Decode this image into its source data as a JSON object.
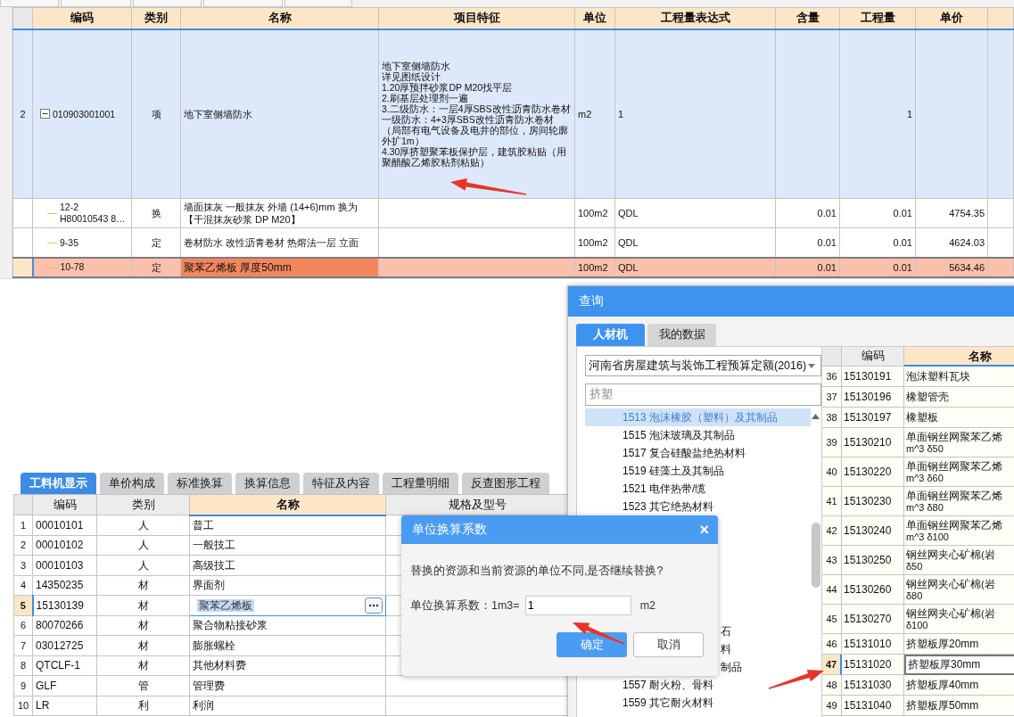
{
  "main_table": {
    "columns": [
      "编码",
      "类别",
      "名称",
      "项目特征",
      "单位",
      "工程量表达式",
      "含量",
      "工程量",
      "单价"
    ],
    "rows": [
      {
        "kind": "list_item",
        "number": "2",
        "code_lines": [
          "010903001001"
        ],
        "expanded": true,
        "category": "项",
        "name": "地下室侧墙防水",
        "features": [
          "地下室侧墙防水",
          "详见图纸设计",
          "1.20厚预拌砂浆DP M20找平层",
          "2.刷基层处理剂一遍",
          "3.二级防水：一层4厚SBS改性沥青防水卷材",
          "一级防水：4+3厚SBS改性沥青防水卷材（局部有电气设备及电井的部位，房间轮廓外扩1m）",
          "4.30厚挤塑聚苯板保护层，建筑胶粘贴（用聚醋酸乙烯胶粘剂粘贴）"
        ],
        "unit": "m2",
        "expression": "1",
        "quantity": "1",
        "selected": false
      },
      {
        "kind": "quota",
        "code_lines": [
          "12-2",
          "H80010543 8…"
        ],
        "category": "换",
        "name": "墙面抹灰 一般抹灰 外墙 (14+6)mm  换为【干混抹灰砂浆 DP M20】",
        "unit": "100m2",
        "expression": "QDL",
        "content": "0.01",
        "quantity": "0.01",
        "price": "4754.35",
        "selected": false
      },
      {
        "kind": "quota",
        "code_lines": [
          "9-35"
        ],
        "category": "定",
        "name": "卷材防水 改性沥青卷材 热熔法一层 立面",
        "unit": "100m2",
        "expression": "QDL",
        "content": "0.01",
        "quantity": "0.01",
        "price": "4624.03",
        "selected": false
      },
      {
        "kind": "quota",
        "code_lines": [
          "10-78"
        ],
        "category": "定",
        "name": "聚苯乙烯板 厚度50mm",
        "unit": "100m2",
        "expression": "QDL",
        "content": "0.01",
        "quantity": "0.01",
        "price": "5634.46",
        "selected": true
      }
    ]
  },
  "detail_tabs": [
    {
      "label": "工料机显示",
      "selected": true
    },
    {
      "label": "单价构成",
      "selected": false
    },
    {
      "label": "标准换算",
      "selected": false
    },
    {
      "label": "换算信息",
      "selected": false
    },
    {
      "label": "特征及内容",
      "selected": false
    },
    {
      "label": "工程量明细",
      "selected": false
    },
    {
      "label": "反查图形工程",
      "selected": false
    }
  ],
  "resource_table": {
    "columns": [
      "编码",
      "类别",
      "名称",
      "规格及型号"
    ],
    "rows": [
      {
        "number": "1",
        "code": "00010101",
        "category": "人",
        "name": "普工",
        "selected": false
      },
      {
        "number": "2",
        "code": "00010102",
        "category": "人",
        "name": "一般技工",
        "selected": false
      },
      {
        "number": "3",
        "code": "00010103",
        "category": "人",
        "name": "高级技工",
        "selected": false
      },
      {
        "number": "4",
        "code": "14350235",
        "category": "材",
        "name": "界面剂",
        "selected": false
      },
      {
        "number": "5",
        "code": "15130139",
        "category": "材",
        "name": "聚苯乙烯板",
        "selected": true
      },
      {
        "number": "6",
        "code": "80070266",
        "category": "材",
        "name": "聚合物粘接砂浆",
        "selected": false
      },
      {
        "number": "7",
        "code": "03012725",
        "category": "材",
        "name": "膨胀螺栓",
        "selected": false
      },
      {
        "number": "8",
        "code": "QTCLF-1",
        "category": "材",
        "name": "其他材料费",
        "selected": false
      },
      {
        "number": "9",
        "code": "GLF",
        "category": "管",
        "name": "管理费",
        "selected": false
      },
      {
        "number": "10",
        "code": "LR",
        "category": "利",
        "name": "利润",
        "selected": false
      }
    ]
  },
  "query_dialog": {
    "title": "查询",
    "tabs": [
      {
        "label": "人材机",
        "selected": true
      },
      {
        "label": "我的数据",
        "selected": false
      }
    ],
    "library": "河南省房屋建筑与装饰工程预算定额(2016)",
    "search": {
      "value": "挤塑"
    },
    "tree": [
      {
        "label": "1513 泡沫橡胶（塑料）及其制品",
        "kind": "normal",
        "selected": true
      },
      {
        "label": "1515 泡沫玻璃及其制品",
        "kind": "normal",
        "selected": false
      },
      {
        "label": "1517 复合硅酸盐绝热材料",
        "kind": "normal",
        "selected": false
      },
      {
        "label": "1519 硅藻土及其制品",
        "kind": "normal",
        "selected": false
      },
      {
        "label": "1521 电伴热带/缆",
        "kind": "normal",
        "selected": false
      },
      {
        "label": "1523 其它绝热材料",
        "kind": "normal",
        "selected": false
      },
      {
        "label": "石",
        "kind": "partial",
        "selected": false
      },
      {
        "label": "料",
        "kind": "partial",
        "selected": false
      },
      {
        "label": "制品",
        "kind": "partial",
        "selected": false
      },
      {
        "label": "1557 耐火粉、骨料",
        "kind": "normal",
        "selected": false
      },
      {
        "label": "1559 其它耐火材料",
        "kind": "normal",
        "selected": false
      }
    ],
    "grid": {
      "columns": [
        "编码",
        "名称"
      ],
      "rows": [
        {
          "number": "36",
          "code": "15130191",
          "name": "泡沫塑料瓦块",
          "selected": false
        },
        {
          "number": "37",
          "code": "15130196",
          "name": "橡塑管壳",
          "selected": false
        },
        {
          "number": "38",
          "code": "15130197",
          "name": "橡塑板",
          "selected": false
        },
        {
          "number": "39",
          "code": "15130210",
          "name": "单面钢丝网聚苯乙烯",
          "detail": "m^3 δ50",
          "selected": false
        },
        {
          "number": "40",
          "code": "15130220",
          "name": "单面钢丝网聚苯乙烯",
          "detail": "m^3 δ60",
          "selected": false
        },
        {
          "number": "41",
          "code": "15130230",
          "name": "单面钢丝网聚苯乙烯",
          "detail": "m^3 δ80",
          "selected": false
        },
        {
          "number": "42",
          "code": "15130240",
          "name": "单面钢丝网聚苯乙烯",
          "detail": "m^3 δ100",
          "selected": false
        },
        {
          "number": "43",
          "code": "15130250",
          "name": "钢丝网夹心矿棉(岩",
          "detail": "δ50",
          "selected": false
        },
        {
          "number": "44",
          "code": "15130260",
          "name": "钢丝网夹心矿棉(岩",
          "detail": "δ80",
          "selected": false
        },
        {
          "number": "45",
          "code": "15130270",
          "name": "钢丝网夹心矿棉(岩",
          "detail": "δ100",
          "selected": false
        },
        {
          "number": "46",
          "code": "15131010",
          "name": "挤塑板厚20mm",
          "selected": false
        },
        {
          "number": "47",
          "code": "15131020",
          "name": "挤塑板厚30mm",
          "selected": true
        },
        {
          "number": "48",
          "code": "15131030",
          "name": "挤塑板厚40mm",
          "selected": false
        },
        {
          "number": "49",
          "code": "15131040",
          "name": "挤塑板厚50mm",
          "selected": false
        }
      ]
    }
  },
  "unit_dialog": {
    "title": "单位换算系数",
    "close": "×",
    "message": "替换的资源和当前资源的单位不同,是否继续替换?",
    "coefficient": {
      "label": "单位换算系数：1m3=",
      "value": "1",
      "unit": "m2"
    },
    "buttons": [
      {
        "label": "确定",
        "kind": "primary"
      },
      {
        "label": "取消",
        "kind": "default"
      }
    ]
  }
}
